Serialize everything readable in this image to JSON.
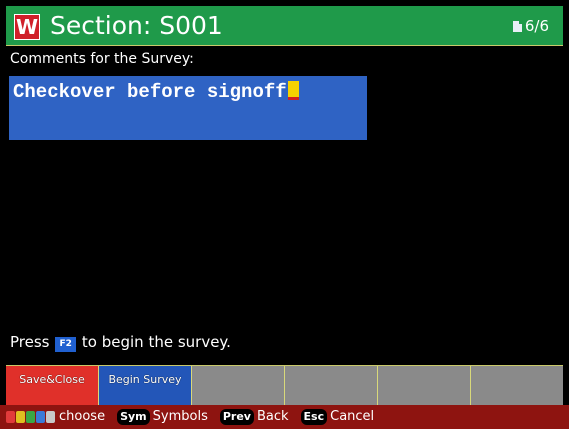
{
  "header": {
    "logo_letter": "W",
    "title": "Section: S001",
    "page_indicator": "6/6",
    "colors": {
      "bar": "#1f9a4a",
      "logo": "#d0202a"
    }
  },
  "main": {
    "comment_label": "Comments for the Survey:",
    "comment_value": "Checkover before signoff",
    "prompt_before": "Press",
    "prompt_key": "F2",
    "prompt_after": "to begin the survey."
  },
  "softkeys": [
    {
      "label": "Save&Close",
      "color": "#e0302a"
    },
    {
      "label": "Begin Survey",
      "color": "#2356b8"
    },
    {
      "label": ""
    },
    {
      "label": ""
    },
    {
      "label": ""
    },
    {
      "label": ""
    }
  ],
  "legend": {
    "colors": [
      "#e23b3b",
      "#e0c020",
      "#3aa845",
      "#3a7ad8",
      "#c8c8c8"
    ],
    "choose": "choose",
    "sym_key": "Sym",
    "sym_label": "Symbols",
    "prev_key": "Prev",
    "prev_label": "Back",
    "esc_key": "Esc",
    "esc_label": "Cancel"
  }
}
